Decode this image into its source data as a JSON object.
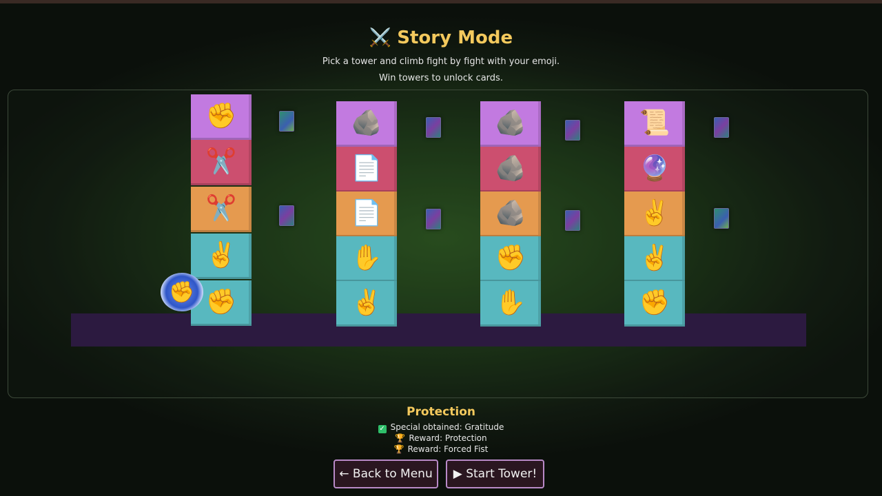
{
  "header": {
    "title_icon": "⚔️",
    "title": "Story Mode",
    "subtitle_1": "Pick a tower and climb fight by fight with your emoji.",
    "subtitle_2": "Win towers to unlock cards."
  },
  "towers": [
    {
      "blocks": [
        {
          "color": "purple",
          "emoji": "✊",
          "icon": "orange-fist-icon"
        },
        {
          "color": "pink",
          "emoji": "✂️",
          "icon": "scissors-icon"
        },
        {
          "color": "orange",
          "emoji": "✂️",
          "icon": "scissors-icon"
        },
        {
          "color": "teal",
          "emoji": "✌️",
          "icon": "green-peace-hand-icon"
        },
        {
          "color": "teal",
          "emoji": "✊",
          "icon": "green-fist-icon"
        }
      ]
    },
    {
      "blocks": [
        {
          "color": "purple",
          "emoji": "🪨",
          "icon": "rock-icon"
        },
        {
          "color": "pink",
          "emoji": "📄",
          "icon": "paper-icon"
        },
        {
          "color": "orange",
          "emoji": "📄",
          "icon": "paper-icon"
        },
        {
          "color": "teal",
          "emoji": "✋",
          "icon": "green-hand-icon"
        },
        {
          "color": "teal",
          "emoji": "✌️",
          "icon": "blue-peace-hand-icon"
        }
      ]
    },
    {
      "blocks": [
        {
          "color": "purple",
          "emoji": "🪨",
          "icon": "rock-icon"
        },
        {
          "color": "pink",
          "emoji": "🪨",
          "icon": "rock-icon"
        },
        {
          "color": "orange",
          "emoji": "🪨",
          "icon": "rock-icon"
        },
        {
          "color": "teal",
          "emoji": "✊",
          "icon": "green-fist-icon"
        },
        {
          "color": "teal",
          "emoji": "✋",
          "icon": "blue-hand-icon"
        }
      ]
    },
    {
      "blocks": [
        {
          "color": "purple",
          "emoji": "📜",
          "icon": "paper-character-icon"
        },
        {
          "color": "pink",
          "emoji": "🔮",
          "icon": "crystal-orb-icon"
        },
        {
          "color": "orange",
          "emoji": "✌️",
          "icon": "orange-peace-hand-icon"
        },
        {
          "color": "teal",
          "emoji": "✌️",
          "icon": "blue-peace-hand-icon"
        },
        {
          "color": "teal",
          "emoji": "✊",
          "icon": "blue-fist-icon"
        }
      ]
    }
  ],
  "player": {
    "emoji": "✊",
    "icon": "blue-fist-icon"
  },
  "selected": {
    "title": "Protection",
    "special": "Special obtained: Gratitude",
    "reward_1": "Reward: Protection",
    "reward_2": "Reward: Forced Fist"
  },
  "buttons": {
    "back": "← Back to Menu",
    "start": "▶ Start Tower!"
  },
  "colors": {
    "accent": "#f4c95d",
    "purple": "#c27ae0",
    "pink": "#cc4f6f",
    "orange": "#e59a4f",
    "teal": "#58b8bf"
  }
}
